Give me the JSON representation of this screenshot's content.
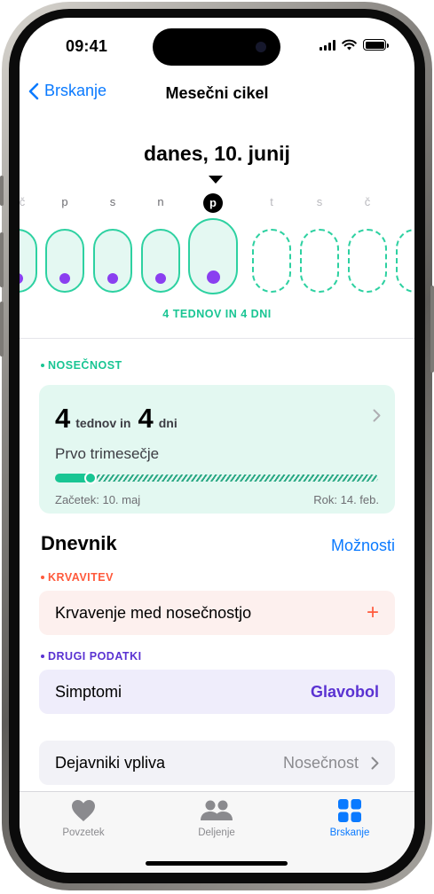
{
  "status": {
    "time": "09:41"
  },
  "nav": {
    "back_label": "Brskanje",
    "title": "Mesečni cikel"
  },
  "date_title": "danes, 10. junij",
  "day_strip": {
    "labels": [
      "č",
      "p",
      "s",
      "n",
      "p",
      "t",
      "s",
      "č"
    ],
    "today_index": 4,
    "weeks_days_label": "4 TEDNOV IN 4 DNI"
  },
  "pregnancy": {
    "section_label": "NOSEČNOST",
    "weeks": "4",
    "weeks_unit": "tednov in",
    "days": "4",
    "days_unit": "dni",
    "trimester": "Prvo trimesečje",
    "progress": 0.11,
    "start": "Začetek: 10. maj",
    "due": "Rok: 14. feb."
  },
  "journal": {
    "title": "Dnevnik",
    "options_label": "Možnosti"
  },
  "bleeding": {
    "section_label": "KRVAVITEV",
    "row_label": "Krvavenje med nosečnostjo"
  },
  "other": {
    "section_label": "DRUGI PODATKI",
    "symptoms_label": "Simptomi",
    "symptoms_value": "Glavobol"
  },
  "factors": {
    "label": "Dejavniki vpliva",
    "value": "Nosečnost"
  },
  "tabs": [
    {
      "label": "Povzetek",
      "icon": "heart-icon"
    },
    {
      "label": "Deljenje",
      "icon": "people-icon"
    },
    {
      "label": "Brskanje",
      "icon": "grid-icon"
    }
  ],
  "colors": {
    "accent": "#0a7aff",
    "teal": "#19c593",
    "purple": "#5a32d2",
    "red": "#ff5a3c"
  }
}
